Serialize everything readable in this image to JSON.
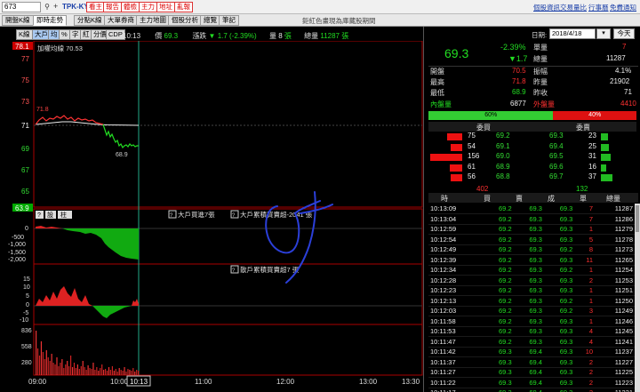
{
  "topbar": {
    "code": "673",
    "stock_name": "TPK-KY",
    "buttons": [
      "看主",
      "報告",
      "體檢",
      "主力",
      "地址",
      "亂報"
    ],
    "links": [
      "個股資訊",
      "交易量比",
      "行事曆",
      "免費通知"
    ]
  },
  "tabs": [
    "開盤K線",
    "即時走勢",
    "分點K線",
    "大單券商",
    "主力地圖",
    "個股分析",
    "總覽",
    "筆記"
  ],
  "marquee": "鉅紅色畫現為庫藏股期間",
  "chart": {
    "toolbar": [
      "K線",
      "大戶",
      "均",
      "%",
      "字",
      "紅",
      "分價",
      "CDP"
    ],
    "time": "10:13",
    "price_label": "價",
    "price": "69.3",
    "change_label": "漲跌",
    "change": "▼ 1.7 (-2.39%)",
    "vol_label": "量",
    "vol": "8",
    "vol_unit": "張",
    "total_label": "總量",
    "total": "11287",
    "total_unit": "張",
    "weighted_index_label": "加權均線",
    "weighted_index": "70.53",
    "price_axis": [
      "78.1",
      "77",
      "75",
      "73",
      "71",
      "69",
      "67",
      "65",
      "63.9"
    ],
    "high_mark": "71.8",
    "low_mark": "68.9",
    "panel2_buttons": [
      "?",
      "設",
      "柱"
    ],
    "panel2_title1": "大戶買進7張",
    "panel2_title2": "大戶累積買賣超-2041 張",
    "panel2_axis": [
      "0",
      "-500",
      "-1,000",
      "-1,500",
      "-2,000"
    ],
    "panel3_title": "散戶累積買賣超7 張",
    "panel3_axis": [
      "15",
      "10",
      "5",
      "0",
      "-5",
      "-10"
    ],
    "panel4_axis": [
      "836",
      "558",
      "280"
    ],
    "x_axis": [
      "09:00",
      "10:00",
      "11:00",
      "12:00",
      "13:00",
      "13:30"
    ],
    "cursor_time": "10:13"
  },
  "quote": {
    "date_label": "日期:",
    "date": "2018/4/18",
    "today_btn": "今天",
    "price": "69.3",
    "pct": "-2.39%",
    "chg": "▼1.7",
    "unit_label": "單量",
    "unit_vol": "7",
    "total_label": "總量",
    "total_vol": "11287",
    "rows": [
      {
        "l1": "開盤",
        "v1": "70.5",
        "l2": "振幅",
        "v2": "4.1%"
      },
      {
        "l1": "最高",
        "v1": "71.8",
        "l2": "昨量",
        "v2": "21902"
      },
      {
        "l1": "最低",
        "v1": "68.9",
        "l2": "昨收",
        "v2": "71"
      }
    ],
    "inner_label": "內盤量",
    "inner_vol": "6877",
    "outer_label": "外盤量",
    "outer_vol": "4410",
    "inner_pct": "60%",
    "outer_pct": "40%",
    "inner_fraction": 0.6,
    "bid_head": "委買",
    "ask_head": "委賣",
    "book": [
      {
        "bq": "75",
        "bp": "69.2",
        "ap": "69.3",
        "aq": "23",
        "bqf": 0.48,
        "aqf": 0.22
      },
      {
        "bq": "54",
        "bp": "69.1",
        "ap": "69.4",
        "aq": "25",
        "bqf": 0.35,
        "aqf": 0.24
      },
      {
        "bq": "156",
        "bp": "69.0",
        "ap": "69.5",
        "aq": "31",
        "bqf": 1.0,
        "aqf": 0.3
      },
      {
        "bq": "61",
        "bp": "68.9",
        "ap": "69.6",
        "aq": "16",
        "bqf": 0.39,
        "aqf": 0.16
      },
      {
        "bq": "56",
        "bp": "68.8",
        "ap": "69.7",
        "aq": "37",
        "bqf": 0.36,
        "aqf": 0.36
      }
    ],
    "bid_total": "402",
    "ask_total": "132",
    "tick_headers": [
      "時",
      "買",
      "賣",
      "成",
      "單",
      "總量"
    ],
    "ticks": [
      [
        "10:13:09",
        "69.2",
        "69.3",
        "69.3",
        "7",
        "11287"
      ],
      [
        "10:13:04",
        "69.2",
        "69.3",
        "69.3",
        "7",
        "11286"
      ],
      [
        "10:12:59",
        "69.2",
        "69.3",
        "69.3",
        "1",
        "11279"
      ],
      [
        "10:12:54",
        "69.2",
        "69.3",
        "69.3",
        "5",
        "11278"
      ],
      [
        "10:12:49",
        "69.2",
        "69.3",
        "69.2",
        "8",
        "11273"
      ],
      [
        "10:12:39",
        "69.2",
        "69.3",
        "69.3",
        "11",
        "11265"
      ],
      [
        "10:12:34",
        "69.2",
        "69.3",
        "69.2",
        "1",
        "11254"
      ],
      [
        "10:12:28",
        "69.2",
        "69.3",
        "69.3",
        "2",
        "11253"
      ],
      [
        "10:12:23",
        "69.2",
        "69.3",
        "69.3",
        "1",
        "11251"
      ],
      [
        "10:12:13",
        "69.2",
        "69.3",
        "69.2",
        "1",
        "11250"
      ],
      [
        "10:12:03",
        "69.2",
        "69.3",
        "69.2",
        "3",
        "11249"
      ],
      [
        "10:11:58",
        "69.2",
        "69.3",
        "69.3",
        "1",
        "11246"
      ],
      [
        "10:11:53",
        "69.2",
        "69.3",
        "69.3",
        "4",
        "11245"
      ],
      [
        "10:11:47",
        "69.2",
        "69.3",
        "69.3",
        "4",
        "11241"
      ],
      [
        "10:11:42",
        "69.3",
        "69.4",
        "69.3",
        "10",
        "11237"
      ],
      [
        "10:11:37",
        "69.3",
        "69.4",
        "69.3",
        "2",
        "11227"
      ],
      [
        "10:11:27",
        "69.3",
        "69.4",
        "69.3",
        "2",
        "11225"
      ],
      [
        "10:11:22",
        "69.3",
        "69.4",
        "69.3",
        "2",
        "11223"
      ],
      [
        "10:11:17",
        "69.3",
        "69.4",
        "69.3",
        "2",
        "11221"
      ]
    ]
  }
}
